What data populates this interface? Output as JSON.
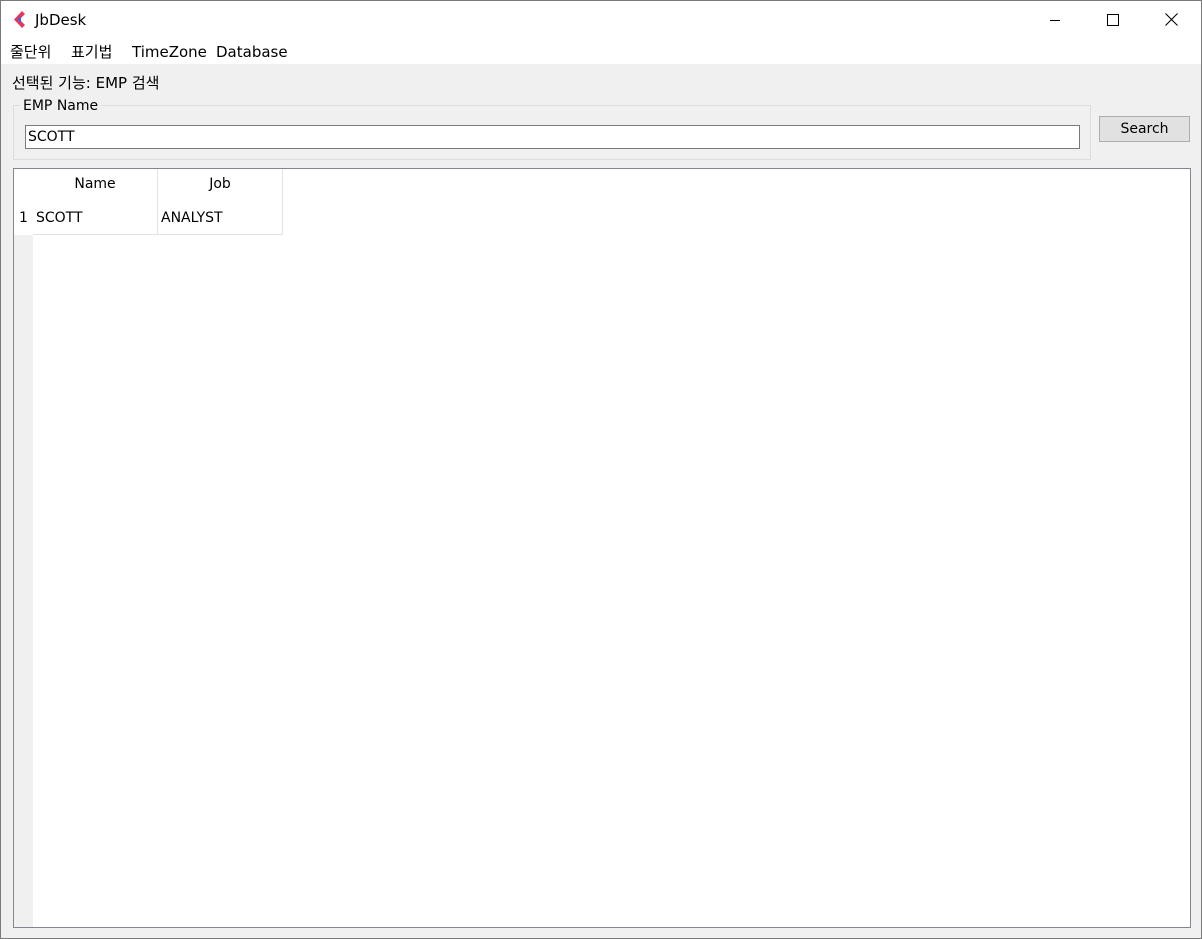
{
  "window": {
    "title": "JbDesk",
    "icon": "jbdesk-app-icon",
    "controls": {
      "minimize_icon": "minimize-icon",
      "maximize_icon": "maximize-icon",
      "close_icon": "close-icon"
    }
  },
  "menu": {
    "items": [
      {
        "label": "줄단위"
      },
      {
        "label": "표기법"
      },
      {
        "label": "TimeZone"
      },
      {
        "label": "Database"
      }
    ]
  },
  "selected_function": {
    "text": "선택된 기능: EMP 검색"
  },
  "search_group": {
    "title": "EMP Name",
    "input_value": "SCOTT",
    "button_label": "Search"
  },
  "grid": {
    "columns": [
      "Name",
      "Job"
    ],
    "rows": [
      {
        "index": "1",
        "cells": [
          "SCOTT",
          "ANALYST"
        ]
      }
    ]
  },
  "colors": {
    "window_bg": "#f0f0f0",
    "icon_pink": "#e8365d",
    "icon_blue": "#2f6fd8"
  }
}
